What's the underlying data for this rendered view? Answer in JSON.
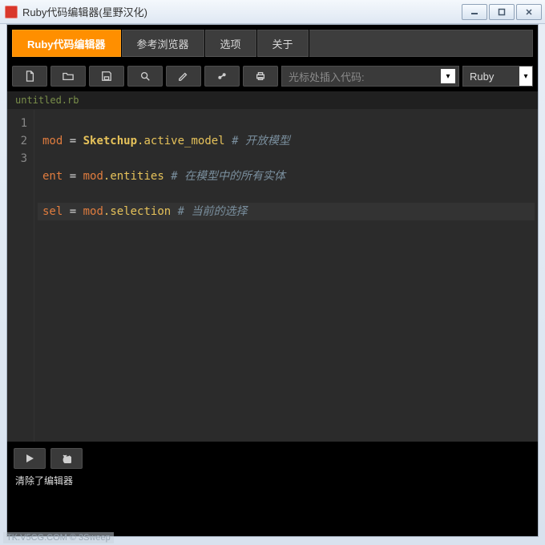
{
  "window": {
    "title": "Ruby代码编辑器(星野汉化)"
  },
  "tabs": [
    {
      "label": "Ruby代码编辑器",
      "active": true
    },
    {
      "label": "参考浏览器",
      "active": false
    },
    {
      "label": "选项",
      "active": false
    },
    {
      "label": "关于",
      "active": false
    }
  ],
  "toolbar": {
    "insert_placeholder": "光标处插入代码:",
    "language": "Ruby"
  },
  "file": {
    "name": "untitled.rb"
  },
  "code_lines": [
    {
      "n": "1",
      "ident": "mod",
      "eq": " = ",
      "mod": "Sketchup",
      "dot": ".",
      "call": "active_model",
      "comment": "# 开放模型"
    },
    {
      "n": "2",
      "ident": "ent",
      "eq": " = ",
      "mod": "mod",
      "dot": ".",
      "call": "entities",
      "comment": "# 在模型中的所有实体"
    },
    {
      "n": "3",
      "ident": "sel",
      "eq": " = ",
      "mod": "mod",
      "dot": ".",
      "call": "selection",
      "comment": "# 当前的选择"
    }
  ],
  "console": {
    "line1": "清除了编辑器"
  },
  "footer": {
    "text": "TK.V5CG.COM © 3Sweep"
  }
}
